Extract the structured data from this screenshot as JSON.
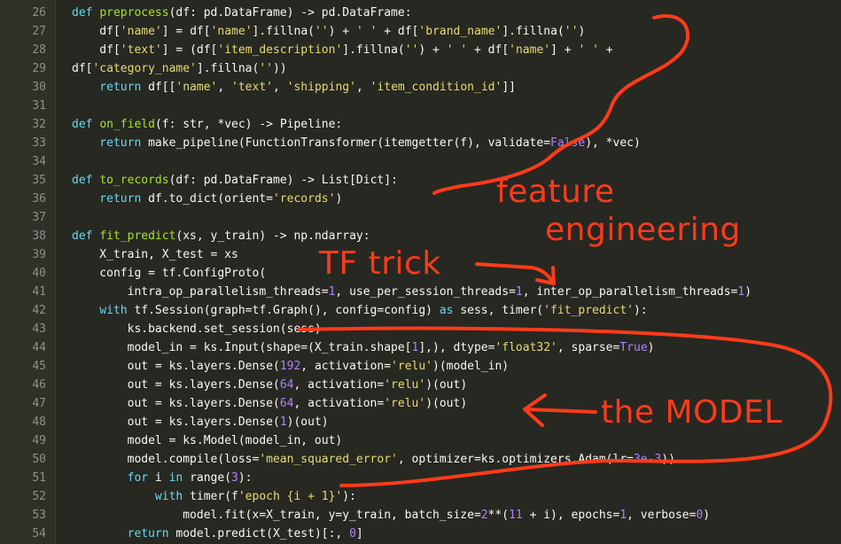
{
  "editor": {
    "colors": {
      "background": "#272822",
      "gutter": "#2f3129",
      "line_number": "#8f908a",
      "text": "#f8f8f2",
      "keyword": "#66d9ef",
      "function": "#a6e22e",
      "string": "#e6db74",
      "number": "#ae81ff",
      "operator": "#f92672",
      "annotation": "#ff3b1a"
    },
    "lines": [
      {
        "n": "26",
        "tokens": [
          [
            "kw",
            "def "
          ],
          [
            "fn",
            "preprocess"
          ],
          [
            "",
            "(df: pd.DataFrame) -> pd.DataFrame:"
          ]
        ]
      },
      {
        "n": "27",
        "tokens": [
          [
            "",
            "    df["
          ],
          [
            "st",
            "'name'"
          ],
          [
            "",
            "] = df["
          ],
          [
            "st",
            "'name'"
          ],
          [
            "",
            "].fillna("
          ],
          [
            "st",
            "''"
          ],
          [
            "",
            ") + "
          ],
          [
            "st",
            "' '"
          ],
          [
            "",
            " + df["
          ],
          [
            "st",
            "'brand_name'"
          ],
          [
            "",
            "].fillna("
          ],
          [
            "st",
            "''"
          ],
          [
            "",
            ")"
          ]
        ]
      },
      {
        "n": "28",
        "tokens": [
          [
            "",
            "    df["
          ],
          [
            "st",
            "'text'"
          ],
          [
            "",
            "] = (df["
          ],
          [
            "st",
            "'item_description'"
          ],
          [
            "",
            "].fillna("
          ],
          [
            "st",
            "''"
          ],
          [
            "",
            ") + "
          ],
          [
            "st",
            "' '"
          ],
          [
            "",
            " + df["
          ],
          [
            "st",
            "'name'"
          ],
          [
            "",
            "] + "
          ],
          [
            "st",
            "' '"
          ],
          [
            "",
            " +"
          ]
        ]
      },
      {
        "n": "29",
        "tokens": [
          [
            "",
            "df["
          ],
          [
            "st",
            "'category_name'"
          ],
          [
            "",
            "].fillna("
          ],
          [
            "st",
            "''"
          ],
          [
            "",
            "))"
          ]
        ]
      },
      {
        "n": "30",
        "tokens": [
          [
            "kw",
            "    return "
          ],
          [
            "",
            "df[["
          ],
          [
            "st",
            "'name'"
          ],
          [
            "",
            ", "
          ],
          [
            "st",
            "'text'"
          ],
          [
            "",
            ", "
          ],
          [
            "st",
            "'shipping'"
          ],
          [
            "",
            ", "
          ],
          [
            "st",
            "'item_condition_id'"
          ],
          [
            "",
            "]]"
          ]
        ]
      },
      {
        "n": "31",
        "tokens": []
      },
      {
        "n": "32",
        "tokens": [
          [
            "kw",
            "def "
          ],
          [
            "fn",
            "on_field"
          ],
          [
            "",
            "(f: str, *vec) -> Pipeline:"
          ]
        ]
      },
      {
        "n": "33",
        "tokens": [
          [
            "kw",
            "    return "
          ],
          [
            "",
            "make_pipeline(FunctionTransformer(itemgetter(f), validate="
          ],
          [
            "nm",
            "False"
          ],
          [
            "",
            "), *vec)"
          ]
        ]
      },
      {
        "n": "34",
        "tokens": []
      },
      {
        "n": "35",
        "tokens": [
          [
            "kw",
            "def "
          ],
          [
            "fn",
            "to_records"
          ],
          [
            "",
            "(df: pd.DataFrame) -> List[Dict]:"
          ]
        ]
      },
      {
        "n": "36",
        "tokens": [
          [
            "kw",
            "    return "
          ],
          [
            "",
            "df.to_dict(orient="
          ],
          [
            "st",
            "'records'"
          ],
          [
            "",
            ")"
          ]
        ]
      },
      {
        "n": "37",
        "tokens": []
      },
      {
        "n": "38",
        "tokens": [
          [
            "kw",
            "def "
          ],
          [
            "fn",
            "fit_predict"
          ],
          [
            "",
            "(xs, y_train) -> np.ndarray:"
          ]
        ]
      },
      {
        "n": "39",
        "tokens": [
          [
            "",
            "    X_train, X_test = xs"
          ]
        ]
      },
      {
        "n": "40",
        "tokens": [
          [
            "",
            "    config = tf.ConfigProto("
          ]
        ]
      },
      {
        "n": "41",
        "tokens": [
          [
            "",
            "        intra_op_parallelism_threads="
          ],
          [
            "nm",
            "1"
          ],
          [
            "",
            ", use_per_session_threads="
          ],
          [
            "nm",
            "1"
          ],
          [
            "",
            ", inter_op_parallelism_threads="
          ],
          [
            "nm",
            "1"
          ],
          [
            "",
            ")"
          ]
        ]
      },
      {
        "n": "42",
        "tokens": [
          [
            "kw",
            "    with "
          ],
          [
            "",
            "tf.Session(graph=tf.Graph(), config=config) "
          ],
          [
            "kw",
            "as "
          ],
          [
            "",
            "sess, timer("
          ],
          [
            "st",
            "'fit_predict'"
          ],
          [
            "",
            "):"
          ]
        ]
      },
      {
        "n": "43",
        "tokens": [
          [
            "",
            "        ks.backend.set_session(sess)"
          ]
        ]
      },
      {
        "n": "44",
        "tokens": [
          [
            "",
            "        model_in = ks.Input(shape=(X_train.shape["
          ],
          [
            "nm",
            "1"
          ],
          [
            "",
            "],), dtype="
          ],
          [
            "st",
            "'float32'"
          ],
          [
            "",
            ", sparse="
          ],
          [
            "nm",
            "True"
          ],
          [
            "",
            ")"
          ]
        ]
      },
      {
        "n": "45",
        "tokens": [
          [
            "",
            "        out = ks.layers.Dense("
          ],
          [
            "nm",
            "192"
          ],
          [
            "",
            ", activation="
          ],
          [
            "st",
            "'relu'"
          ],
          [
            "",
            ")(model_in)"
          ]
        ]
      },
      {
        "n": "46",
        "tokens": [
          [
            "",
            "        out = ks.layers.Dense("
          ],
          [
            "nm",
            "64"
          ],
          [
            "",
            ", activation="
          ],
          [
            "st",
            "'relu'"
          ],
          [
            "",
            ")(out)"
          ]
        ]
      },
      {
        "n": "47",
        "tokens": [
          [
            "",
            "        out = ks.layers.Dense("
          ],
          [
            "nm",
            "64"
          ],
          [
            "",
            ", activation="
          ],
          [
            "st",
            "'relu'"
          ],
          [
            "",
            ")(out)"
          ]
        ]
      },
      {
        "n": "48",
        "tokens": [
          [
            "",
            "        out = ks.layers.Dense("
          ],
          [
            "nm",
            "1"
          ],
          [
            "",
            ")(out)"
          ]
        ]
      },
      {
        "n": "49",
        "tokens": [
          [
            "",
            "        model = ks.Model(model_in, out)"
          ]
        ]
      },
      {
        "n": "50",
        "tokens": [
          [
            "",
            "        model.compile(loss="
          ],
          [
            "st",
            "'mean_squared_error'"
          ],
          [
            "",
            ", optimizer=ks.optimizers.Adam(lr="
          ],
          [
            "nm",
            "3e-3"
          ],
          [
            "",
            "))"
          ]
        ]
      },
      {
        "n": "51",
        "tokens": [
          [
            "kw",
            "        for "
          ],
          [
            "",
            "i "
          ],
          [
            "kw",
            "in "
          ],
          [
            "",
            "range("
          ],
          [
            "nm",
            "3"
          ],
          [
            "",
            "):"
          ]
        ]
      },
      {
        "n": "52",
        "tokens": [
          [
            "kw",
            "            with "
          ],
          [
            "",
            "timer(f"
          ],
          [
            "st",
            "'epoch {i + 1}'"
          ],
          [
            "",
            "):"
          ]
        ]
      },
      {
        "n": "53",
        "tokens": [
          [
            "",
            "                model.fit(x=X_train, y=y_train, batch_size="
          ],
          [
            "nm",
            "2"
          ],
          [
            "",
            "**("
          ],
          [
            "nm",
            "11"
          ],
          [
            "",
            " + i), epochs="
          ],
          [
            "nm",
            "1"
          ],
          [
            "",
            ", verbose="
          ],
          [
            "nm",
            "0"
          ],
          [
            "",
            ")"
          ]
        ]
      },
      {
        "n": "54",
        "tokens": [
          [
            "kw",
            "        return "
          ],
          [
            "",
            "model.predict(X_test)[:, "
          ],
          [
            "nm",
            "0"
          ],
          [
            "",
            "]"
          ]
        ]
      }
    ]
  },
  "annotations": {
    "feature": "feature",
    "engineering": "engineering",
    "tf_trick": "TF trick",
    "the_model": "the MODEL"
  }
}
